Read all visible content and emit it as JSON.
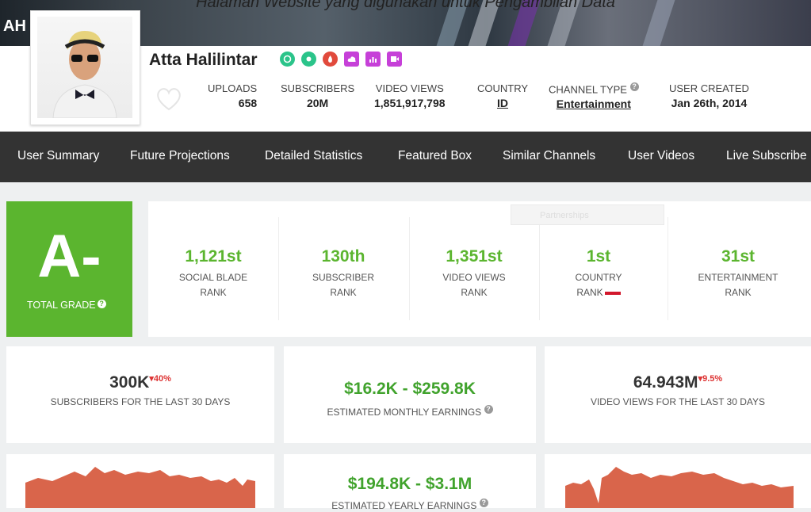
{
  "caption": "Halaman Website yang digunakan untuk Pengambilan Data",
  "banner": {
    "text": "AH"
  },
  "channel": {
    "name": "Atta Halilintar",
    "badges": [
      {
        "icon": "clock-icon",
        "color": "#2bc48a"
      },
      {
        "icon": "eye-icon",
        "color": "#2bc48a"
      },
      {
        "icon": "fire-icon",
        "color": "#e14a3c"
      },
      {
        "icon": "cloud-icon",
        "color": "#c640d8"
      },
      {
        "icon": "chart-icon",
        "color": "#c640d8"
      },
      {
        "icon": "video-icon",
        "color": "#c640d8"
      }
    ]
  },
  "stats": {
    "uploads": {
      "label": "UPLOADS",
      "value": "658"
    },
    "subscribers": {
      "label": "SUBSCRIBERS",
      "value": "20M"
    },
    "video_views": {
      "label": "VIDEO VIEWS",
      "value": "1,851,917,798"
    },
    "country": {
      "label": "COUNTRY",
      "value": "ID"
    },
    "channel_type": {
      "label": "CHANNEL TYPE",
      "value": "Entertainment"
    },
    "user_created": {
      "label": "USER CREATED",
      "value": "Jan 26th, 2014"
    }
  },
  "nav": {
    "items": [
      "User Summary",
      "Future Projections",
      "Detailed Statistics",
      "Featured Box",
      "Similar Channels",
      "User Videos",
      "Live Subscribe"
    ]
  },
  "grade": {
    "letter": "A-",
    "label": "TOTAL GRADE"
  },
  "ranks": [
    {
      "value": "1,121st",
      "line1": "SOCIAL BLADE",
      "line2": "RANK"
    },
    {
      "value": "130th",
      "line1": "SUBSCRIBER",
      "line2": "RANK"
    },
    {
      "value": "1,351st",
      "line1": "VIDEO VIEWS",
      "line2": "RANK"
    },
    {
      "value": "1st",
      "line1": "COUNTRY",
      "line2": "RANK"
    },
    {
      "value": "31st",
      "line1": "ENTERTAINMENT",
      "line2": "RANK"
    }
  ],
  "ghost_button": {
    "label": "Partnerships"
  },
  "cards": {
    "subs30": {
      "value": "300K",
      "change": "40%",
      "label": "SUBSCRIBERS FOR THE LAST 30 DAYS"
    },
    "monthly": {
      "value": "$16.2K - $259.8K",
      "label": "ESTIMATED MONTHLY EARNINGS"
    },
    "views30": {
      "value": "64.943M",
      "change": "9.5%",
      "label": "VIDEO VIEWS FOR THE LAST 30 DAYS"
    },
    "yearly": {
      "value": "$194.8K - $3.1M",
      "label": "ESTIMATED YEARLY EARNINGS"
    }
  },
  "colors": {
    "accent_green": "#5bb52f",
    "nav_bg": "#333333",
    "decrease_red": "#d33333",
    "sparkline": "#d9654b"
  }
}
